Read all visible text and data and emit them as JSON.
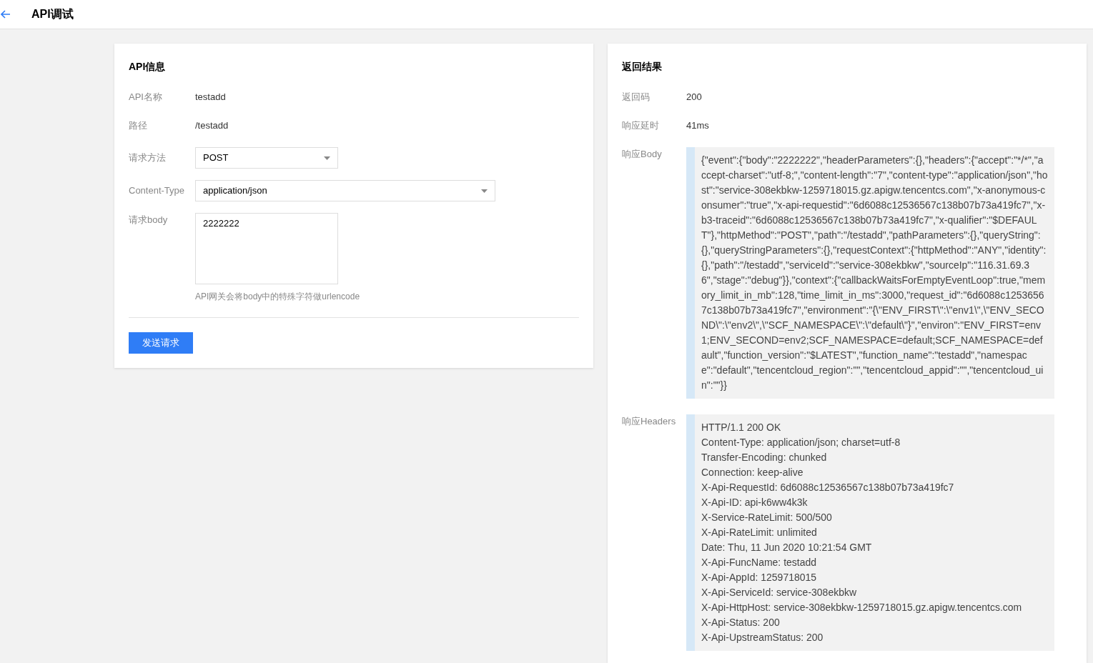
{
  "header": {
    "title": "API调试"
  },
  "api_info": {
    "title": "API信息",
    "fields": [
      {
        "kind": "text",
        "label": "API名称",
        "value": "testadd"
      },
      {
        "kind": "text",
        "label": "路径",
        "value": "/testadd"
      },
      {
        "kind": "select",
        "label": "请求方法",
        "value": "POST"
      },
      {
        "kind": "select",
        "label": "Content-Type",
        "value": "application/json"
      },
      {
        "kind": "textarea",
        "label": "请求body",
        "value": "2222222",
        "hint": "API网关会将body中的特殊字符做urlencode"
      }
    ],
    "send_button": "发送请求"
  },
  "result": {
    "title": "返回结果",
    "fields": [
      {
        "kind": "text",
        "label": "返回码",
        "value": "200"
      },
      {
        "kind": "text",
        "label": "响应延时",
        "value": "41ms"
      },
      {
        "kind": "code",
        "label": "响应Body",
        "value": "{\"event\":{\"body\":\"2222222\",\"headerParameters\":{},\"headers\":{\"accept\":\"*/*\",\"accept-charset\":\"utf-8;\",\"content-length\":\"7\",\"content-type\":\"application/json\",\"host\":\"service-308ekbkw-1259718015.gz.apigw.tencentcs.com\",\"x-anonymous-consumer\":\"true\",\"x-api-requestid\":\"6d6088c12536567c138b07b73a419fc7\",\"x-b3-traceid\":\"6d6088c12536567c138b07b73a419fc7\",\"x-qualifier\":\"$DEFAULT\"},\"httpMethod\":\"POST\",\"path\":\"/testadd\",\"pathParameters\":{},\"queryString\":{},\"queryStringParameters\":{},\"requestContext\":{\"httpMethod\":\"ANY\",\"identity\":{},\"path\":\"/testadd\",\"serviceId\":\"service-308ekbkw\",\"sourceIp\":\"116.31.69.36\",\"stage\":\"debug\"}},\"context\":{\"callbackWaitsForEmptyEventLoop\":true,\"memory_limit_in_mb\":128,\"time_limit_in_ms\":3000,\"request_id\":\"6d6088c12536567c138b07b73a419fc7\",\"environment\":\"{\\\"ENV_FIRST\\\":\\\"env1\\\",\\\"ENV_SECOND\\\":\\\"env2\\\",\\\"SCF_NAMESPACE\\\":\\\"default\\\"}\",\"environ\":\"ENV_FIRST=env1;ENV_SECOND=env2;SCF_NAMESPACE=default;SCF_NAMESPACE=default\",\"function_version\":\"$LATEST\",\"function_name\":\"testadd\",\"namespace\":\"default\",\"tencentcloud_region\":\"\",\"tencentcloud_appid\":\"\",\"tencentcloud_uin\":\"\"}}"
      },
      {
        "kind": "lines",
        "label": "响应Headers",
        "lines": [
          "HTTP/1.1 200 OK",
          "Content-Type: application/json; charset=utf-8",
          "Transfer-Encoding: chunked",
          "Connection: keep-alive",
          "X-Api-RequestId: 6d6088c12536567c138b07b73a419fc7",
          "X-Api-ID: api-k6ww4k3k",
          "X-Service-RateLimit: 500/500",
          "X-Api-RateLimit: unlimited",
          "Date: Thu, 11 Jun 2020 10:21:54 GMT",
          "X-Api-FuncName: testadd",
          "X-Api-AppId: 1259718015",
          "X-Api-ServiceId: service-308ekbkw",
          "X-Api-HttpHost: service-308ekbkw-1259718015.gz.apigw.tencentcs.com",
          "X-Api-Status: 200",
          "X-Api-UpstreamStatus: 200"
        ]
      }
    ]
  }
}
